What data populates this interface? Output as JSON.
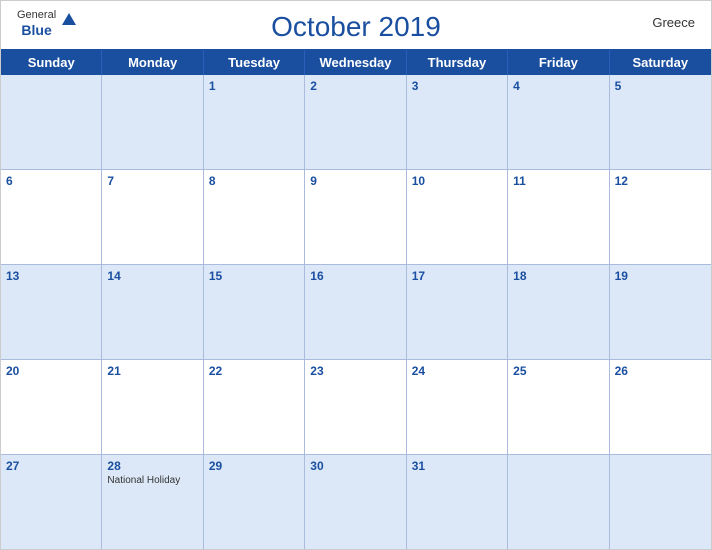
{
  "header": {
    "title": "October 2019",
    "country": "Greece",
    "logo": {
      "general": "General",
      "blue": "Blue"
    }
  },
  "dayHeaders": [
    "Sunday",
    "Monday",
    "Tuesday",
    "Wednesday",
    "Thursday",
    "Friday",
    "Saturday"
  ],
  "weeks": [
    [
      {
        "day": "",
        "empty": true
      },
      {
        "day": "",
        "empty": true
      },
      {
        "day": "1"
      },
      {
        "day": "2"
      },
      {
        "day": "3"
      },
      {
        "day": "4"
      },
      {
        "day": "5"
      }
    ],
    [
      {
        "day": "6"
      },
      {
        "day": "7"
      },
      {
        "day": "8"
      },
      {
        "day": "9"
      },
      {
        "day": "10"
      },
      {
        "day": "11"
      },
      {
        "day": "12"
      }
    ],
    [
      {
        "day": "13"
      },
      {
        "day": "14"
      },
      {
        "day": "15"
      },
      {
        "day": "16"
      },
      {
        "day": "17"
      },
      {
        "day": "18"
      },
      {
        "day": "19"
      }
    ],
    [
      {
        "day": "20"
      },
      {
        "day": "21"
      },
      {
        "day": "22"
      },
      {
        "day": "23"
      },
      {
        "day": "24"
      },
      {
        "day": "25"
      },
      {
        "day": "26"
      }
    ],
    [
      {
        "day": "27"
      },
      {
        "day": "28",
        "holiday": "National Holiday"
      },
      {
        "day": "29"
      },
      {
        "day": "30"
      },
      {
        "day": "31"
      },
      {
        "day": "",
        "empty": true
      },
      {
        "day": "",
        "empty": true
      }
    ]
  ],
  "colors": {
    "primary": "#1a4fa0",
    "headerBg": "#c8d8f0",
    "oddRowBg": "#dce8f8"
  }
}
